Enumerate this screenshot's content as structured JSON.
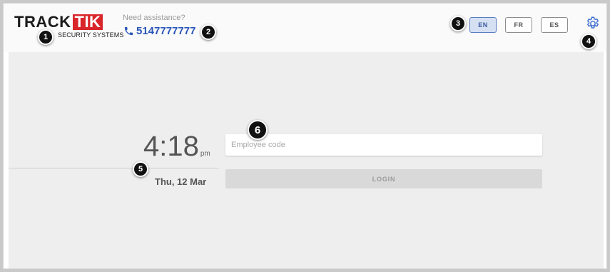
{
  "brand": {
    "logo_word": "TRACK",
    "logo_box": "TIK",
    "logo_sub": "SECURITY SYSTEMS"
  },
  "support": {
    "label": "Need assistance?",
    "phone": "5147777777"
  },
  "languages": [
    {
      "code": "EN",
      "active": true
    },
    {
      "code": "FR",
      "active": false
    },
    {
      "code": "ES",
      "active": false
    }
  ],
  "clock": {
    "time": "4:18",
    "ampm": "pm",
    "date": "Thu, 12 Mar"
  },
  "form": {
    "employee_placeholder": "Employee code",
    "login_label": "LOGIN"
  },
  "callouts": [
    "1",
    "2",
    "3",
    "4",
    "5",
    "6"
  ],
  "colors": {
    "brand_red": "#d9262b",
    "phone_blue": "#2a56b8",
    "active_lang_bg": "#d5e0f3"
  }
}
